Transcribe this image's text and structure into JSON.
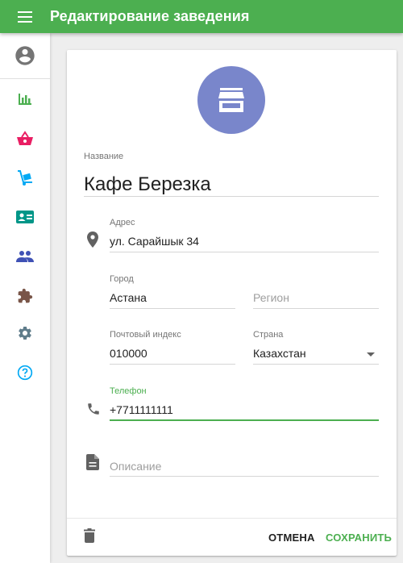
{
  "app": {
    "title": "Редактирование заведения"
  },
  "sidebar": {
    "icons": [
      "account-circle-icon",
      "bar-chart-icon",
      "basket-icon",
      "dolly-icon",
      "contact-card-icon",
      "people-icon",
      "puzzle-icon",
      "gear-icon",
      "help-icon"
    ],
    "colors": {
      "chart": "#4caf50",
      "basket": "#e91e63",
      "dolly": "#03a9f4",
      "card": "#009688",
      "people": "#3f51b5",
      "puzzle": "#795548",
      "gear": "#607d8b",
      "help": "#03a9f4"
    }
  },
  "form": {
    "name": {
      "label": "Название",
      "value": "Кафе Березка"
    },
    "address": {
      "label": "Адрес",
      "value": "ул. Сарайшык 34"
    },
    "city": {
      "label": "Город",
      "value": "Астана"
    },
    "region": {
      "placeholder": "Регион"
    },
    "postal": {
      "label": "Почтовый индекс",
      "value": "010000"
    },
    "country": {
      "label": "Страна",
      "value": "Казахстан"
    },
    "phone": {
      "label": "Телефон",
      "value": "+7711111111"
    },
    "description": {
      "placeholder": "Описание"
    }
  },
  "actions": {
    "cancel": "ОТМЕНА",
    "save": "СОХРАНИТЬ"
  },
  "colors": {
    "accent": "#4caf50",
    "avatar": "#7986cb"
  }
}
